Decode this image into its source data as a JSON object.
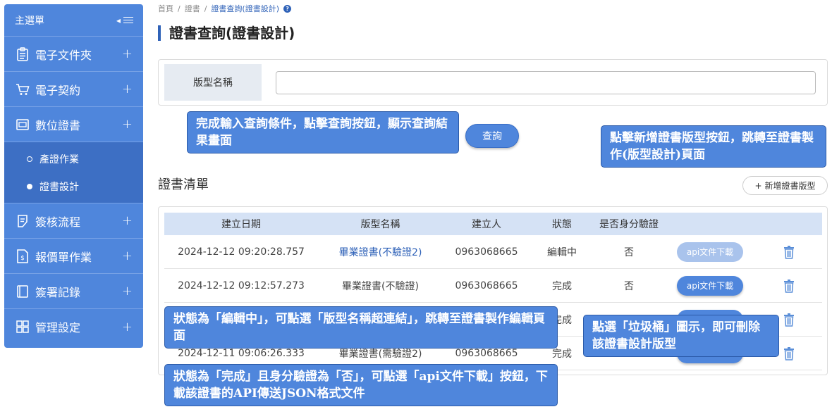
{
  "sidebar": {
    "title": "主選單",
    "items": [
      {
        "label": "電子文件夾",
        "icon": "clipboard-icon"
      },
      {
        "label": "電子契約",
        "icon": "cart-icon"
      },
      {
        "label": "數位證書",
        "icon": "certificate-icon"
      },
      {
        "label": "簽核流程",
        "icon": "edit-note-icon"
      },
      {
        "label": "報價單作業",
        "icon": "invoice-icon"
      },
      {
        "label": "簽署記錄",
        "icon": "book-icon"
      },
      {
        "label": "管理設定",
        "icon": "grid-icon"
      }
    ],
    "sub_items": [
      {
        "label": "產證作業",
        "active": false
      },
      {
        "label": "證書設計",
        "active": true
      }
    ]
  },
  "breadcrumb": {
    "home": "首頁",
    "level2": "證書",
    "current": "證書查詢(證書設計)"
  },
  "page_title": "證書查詢(證書設計)",
  "search": {
    "label": "版型名稱",
    "value": "",
    "query_button": "查詢"
  },
  "list": {
    "title": "證書清單",
    "add_button": "新增證書版型"
  },
  "table": {
    "headers": [
      "建立日期",
      "版型名稱",
      "建立人",
      "狀態",
      "是否身分驗證"
    ],
    "rows": [
      {
        "date": "2024-12-12 09:20:28.757",
        "name": "畢業證書(不驗證2)",
        "creator": "0963068665",
        "status": "編輯中",
        "verify": "否",
        "api": "api文件下載",
        "link": true,
        "api_enabled": false
      },
      {
        "date": "2024-12-12 09:12:57.273",
        "name": "畢業證書(不驗證)",
        "creator": "0963068665",
        "status": "完成",
        "verify": "否",
        "api": "api文件下載",
        "link": false,
        "api_enabled": true
      },
      {
        "date": "",
        "name": "",
        "creator": "",
        "status": "完成",
        "verify": "",
        "api": "",
        "link": false,
        "api_enabled": false
      },
      {
        "date": "2024-12-11 09:06:26.333",
        "name": "畢業證書(需驗證2)",
        "creator": "0963068665",
        "status": "完成",
        "verify": "",
        "api": "",
        "link": false,
        "api_enabled": false
      }
    ]
  },
  "callouts": {
    "query": "完成輸入查詢條件，點擊查詢按鈕，顯示查詢結果畫面",
    "add": "點擊新增證書版型按鈕，跳轉至證書製作(版型設計)頁面",
    "edit": "狀態為「編輯中」，可點選「版型名稱超連結」，跳轉至證書製作編輯頁面",
    "delete": "點選「垃圾桶」圖示，即可刪除該證書設計版型",
    "api": "狀態為「完成」且身分驗證為「否」，可點選「api文件下載」按鈕，下載該證書的API傳送JSON格式文件"
  },
  "colors": {
    "primary": "#4f86dc",
    "sidebar_sub": "#3d6fc4",
    "header_bg": "#d5e2f5",
    "link": "#2f62b8"
  }
}
